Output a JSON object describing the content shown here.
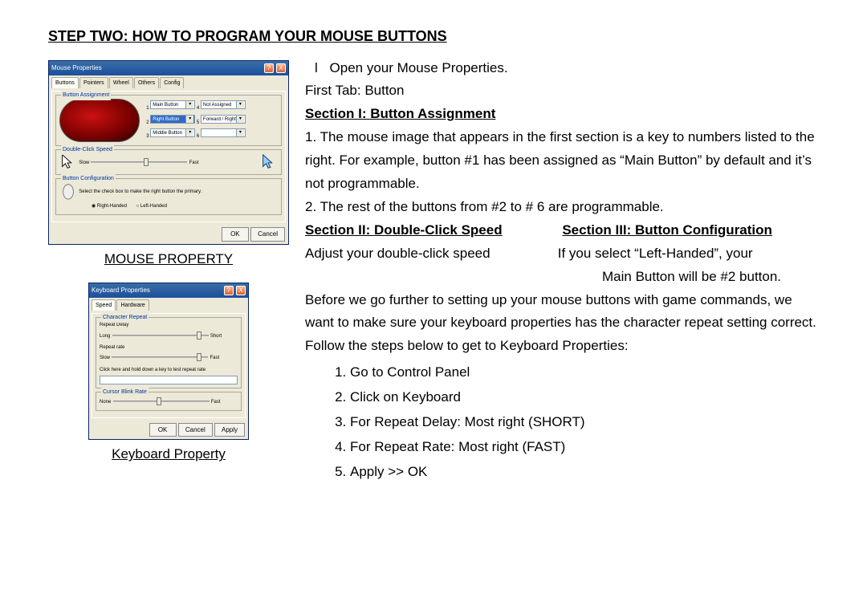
{
  "heading": "STEP TWO:   HOW TO PROGRAM YOUR MOUSE BUTTONS",
  "left": {
    "mouse_caption": "MOUSE PROPERTY",
    "keyboard_caption": "Keyboard Property",
    "mouse_window": {
      "title": "Mouse Properties",
      "close": "X",
      "help": "?",
      "tabs": [
        "Buttons",
        "Pointers",
        "Wheel",
        "Others",
        "Config"
      ],
      "group1": "Button Assignment",
      "dd1": "Main Button",
      "dd1b": "Not Assigned",
      "dd2_sel": "Right Button",
      "dd2b": "Forward / Right Click",
      "dd3": "Middle Button",
      "dd3b": "",
      "group2": "Double-Click Speed",
      "slow": "Slow",
      "fast": "Fast",
      "group3": "Button Configuration",
      "conf_text": "Select the check box to make the right button the primary.",
      "r1": "Right-Handed",
      "r2": "Left-Handed",
      "ok": "OK",
      "cancel": "Cancel"
    },
    "kbd_window": {
      "title": "Keyboard Properties",
      "close": "X",
      "help": "?",
      "tabs": [
        "Speed",
        "Hardware"
      ],
      "g1": "Character Repeat",
      "rd": "Repeat Delay",
      "long_": "Long",
      "short_": "Short",
      "rr": "Repeat rate",
      "slow": "Slow",
      "fast": "Fast",
      "test": "Click here and hold down a key to test repeat rate",
      "g2": "Cursor Blink Rate",
      "none": "None",
      "fast2": "Fast",
      "ok": "OK",
      "cancel": "Cancel",
      "apply": "Apply"
    }
  },
  "r": {
    "bullet": "l",
    "open": "Open your Mouse Properties.",
    "first_tab": "First Tab:   Button",
    "s1": "Section I:   Button Assignment",
    "p1a": "1.    The mouse image that appears in the first section is a key to numbers listed to the right.   For example, button #1 has been assigned as “Main Button” by default and it’s not programmable.",
    "p1b": "2.    The rest of the buttons from #2 to # 6 are programmable.",
    "s2": "Section II:   Double-Click Speed",
    "s3": "Section III:   Button Configuration",
    "s2t": "Adjust your double-click speed",
    "s3t1": "If you select “Left-Handed”, your",
    "s3t2": "Main Button will be #2 button.",
    "before": "Before we go further to setting up your mouse buttons with game commands, we want to make sure your keyboard properties has the character repeat setting correct.   Follow the steps below to get to Keyboard Properties:",
    "steps": [
      "Go to Control Panel",
      "Click on Keyboard",
      "For Repeat Delay:   Most right (SHORT)",
      "For Repeat Rate:   Most right (FAST)",
      "Apply >> OK"
    ]
  }
}
